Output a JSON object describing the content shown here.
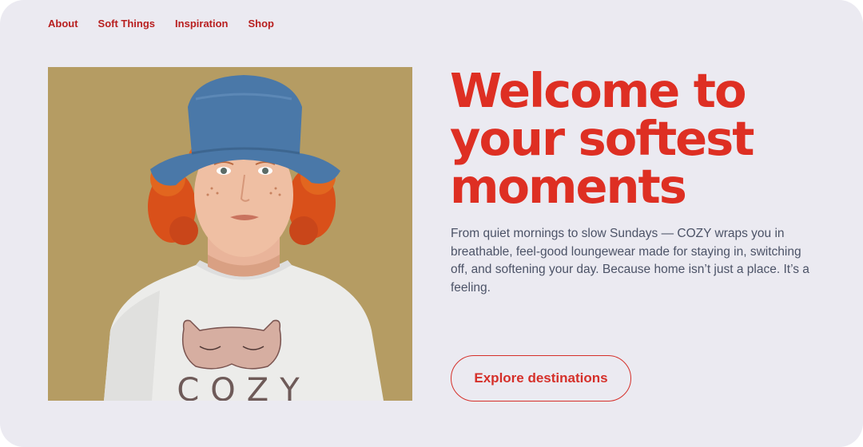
{
  "nav": {
    "items": [
      {
        "label": "About"
      },
      {
        "label": "Soft Things"
      },
      {
        "label": "Inspiration"
      },
      {
        "label": "Shop"
      }
    ]
  },
  "hero": {
    "image_alt": "Model with curly red hair wearing a blue bucket hat and a white COZY t-shirt with sleep mask print",
    "tshirt_logo": "COZY",
    "headline": "Welcome to your softest moments",
    "body": "From quiet mornings to slow Sundays — COZY wraps you in breathable, feel-good loungewear made for staying in, switching off, and softening your day. Because home isn’t just a place. It’s a feeling.",
    "cta_label": "Explore destinations"
  },
  "colors": {
    "accent": "#de2f23",
    "background": "#ebeaf1",
    "body_text": "#4c5367",
    "image_background": "#b59c63",
    "hat": "#4a78a8"
  }
}
